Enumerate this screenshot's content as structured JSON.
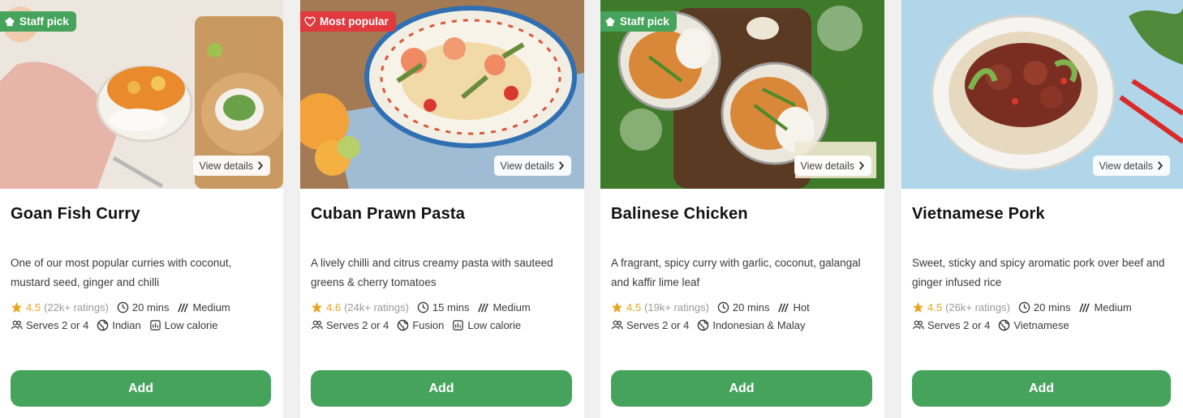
{
  "cards": [
    {
      "badge": "Staff pick",
      "badge_color": "#45a35b",
      "view_details": "View details",
      "title": "Goan Fish Curry",
      "description": "One of our most popular curries with coconut, mustard seed, ginger and chilli",
      "rating": "4.5",
      "ratings_count": "(22k+ ratings)",
      "time": "20 mins",
      "spice": "Medium",
      "serves": "Serves 2 or 4",
      "cuisine": "Indian",
      "tag": "Low calorie",
      "add_label": "Add"
    },
    {
      "badge": "Most popular",
      "badge_color": "#e0393e",
      "view_details": "View details",
      "title": "Cuban Prawn Pasta",
      "description": "A lively chilli and citrus creamy pasta with sauteed greens & cherry tomatoes",
      "rating": "4.6",
      "ratings_count": "(24k+ ratings)",
      "time": "15 mins",
      "spice": "Medium",
      "serves": "Serves 2 or 4",
      "cuisine": "Fusion",
      "tag": "Low calorie",
      "add_label": "Add"
    },
    {
      "badge": "Staff pick",
      "badge_color": "#45a35b",
      "view_details": "View details",
      "title": "Balinese Chicken",
      "description": "A fragrant, spicy curry with garlic, coconut, galangal and kaffir lime leaf",
      "rating": "4.5",
      "ratings_count": "(19k+ ratings)",
      "time": "20 mins",
      "spice": "Hot",
      "serves": "Serves 2 or 4",
      "cuisine": "Indonesian & Malay",
      "add_label": "Add"
    },
    {
      "view_details": "View details",
      "title": "Vietnamese Pork",
      "description": "Sweet, sticky and spicy aromatic pork over beef and ginger infused rice",
      "rating": "4.5",
      "ratings_count": "(26k+ ratings)",
      "time": "20 mins",
      "spice": "Medium",
      "serves": "Serves 2 or 4",
      "cuisine": "Vietnamese",
      "add_label": "Add"
    }
  ],
  "icons": {
    "badge_staff": "chef-hat-icon",
    "badge_popular": "heart-icon",
    "rating": "star-icon",
    "time": "clock-icon",
    "spice": "chilli-icon",
    "serves": "people-icon",
    "cuisine": "globe-icon",
    "tag": "nutrition-icon",
    "details": "chevron-right-icon"
  },
  "colors": {
    "accent": "#45a35b",
    "popular": "#e0393e",
    "star": "#e7a51e"
  }
}
